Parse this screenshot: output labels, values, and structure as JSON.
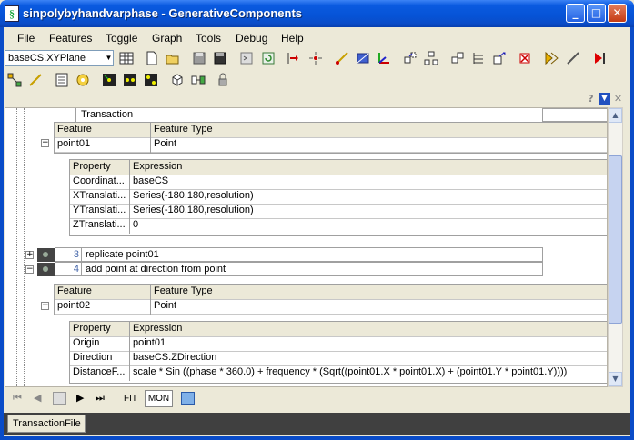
{
  "window": {
    "title": "sinpolybyhandvarphase - GenerativeComponents"
  },
  "menu": [
    "File",
    "Features",
    "Toggle",
    "Graph",
    "Tools",
    "Debug",
    "Help"
  ],
  "toolbar": {
    "combo_value": "baseCS.XYPlane"
  },
  "panel": {
    "transaction_header": "Transaction"
  },
  "block1": {
    "feature_header": "Feature",
    "type_header": "Feature Type",
    "feature": "point01",
    "type": "Point",
    "prop_header": "Property",
    "expr_header": "Expression",
    "rows": [
      {
        "prop": "Coordinat...",
        "expr": "baseCS"
      },
      {
        "prop": "XTranslati...",
        "expr": "Series(-180,180,resolution)"
      },
      {
        "prop": "YTranslati...",
        "expr": "Series(-180,180,resolution)"
      },
      {
        "prop": "ZTranslati...",
        "expr": "0"
      }
    ]
  },
  "transactions": [
    {
      "num": "3",
      "label": "replicate point01"
    },
    {
      "num": "4",
      "label": "add point at direction from point"
    }
  ],
  "block2": {
    "feature_header": "Feature",
    "type_header": "Feature Type",
    "feature": "point02",
    "type": "Point",
    "prop_header": "Property",
    "expr_header": "Expression",
    "rows": [
      {
        "prop": "Origin",
        "expr": "point01"
      },
      {
        "prop": "Direction",
        "expr": "baseCS.ZDirection"
      },
      {
        "prop": "DistanceF...",
        "expr": "scale  * Sin ((phase * 360.0) + frequency * (Sqrt((point01.X * point01.X) + (point01.Y * point01.Y))))"
      }
    ]
  },
  "nav": {
    "fit": "FIT",
    "mon": "MON"
  },
  "tabs": {
    "file_tab": "TransactionFile"
  }
}
